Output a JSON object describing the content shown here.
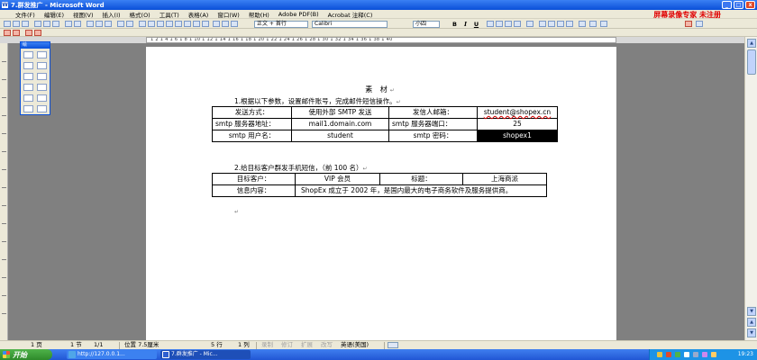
{
  "window": {
    "title": "7.群发推广 - Microsoft Word"
  },
  "menu": {
    "items": [
      "文件(F)",
      "编辑(E)",
      "视图(V)",
      "插入(I)",
      "格式(O)",
      "工具(T)",
      "表格(A)",
      "窗口(W)",
      "帮助(H)",
      "Adobe PDF(B)",
      "Acrobat 注释(C)"
    ],
    "overlay": "屏幕录像专家 未注册"
  },
  "toolbar": {
    "style": "正文 + 首行",
    "font": "Calibri",
    "size": "小四",
    "bold": "B",
    "italic": "I",
    "underline": "U"
  },
  "ruler": {
    "text": "1 2 1 4 1 6 1 8 1 10 1 12 1 14 1 16 1 18 1 20 1 22 1 24 1 26 1 28 1 30 1 32 1 34 1 36 1 38 1 40"
  },
  "palette": {
    "title": "绘"
  },
  "document": {
    "title": "素 材",
    "line1": "1.根据以下参数，设置邮件账号，完成邮件短信操作。",
    "table1": [
      [
        "发送方式：",
        "使用外部 SMTP 发送",
        "发信人邮箱：",
        "student@shopex.cn"
      ],
      [
        "smtp 服务器地址：",
        "mail1.domain.com",
        "smtp 服务器端口：",
        "25"
      ],
      [
        "smtp 用户名：",
        "student",
        "smtp 密码：",
        "shopex1"
      ]
    ],
    "line2": "2.给目标客户群发手机短信，（前 100 名）",
    "table2": {
      "row1": [
        "目标客户：",
        "VIP 会员",
        "标题：",
        "上海商派"
      ],
      "row2_label": "信息内容：",
      "row2_content": "ShopEx 成立于 2002 年，是国内最大的电子商务软件及服务提供商。"
    }
  },
  "status": {
    "page": "1 页",
    "section": "1 节",
    "page_of": "1/1",
    "position": "位置 7.5厘米",
    "line": "5 行",
    "column": "1 列",
    "rec": "录制",
    "trk": "修订",
    "ext": "扩展",
    "ovr": "改写",
    "language": "英语(美国)"
  },
  "taskbar": {
    "start": "开始",
    "tasks": [
      "http://127.0.0.1...",
      "7.群发推广 - Mic..."
    ],
    "clock": "19:23"
  }
}
